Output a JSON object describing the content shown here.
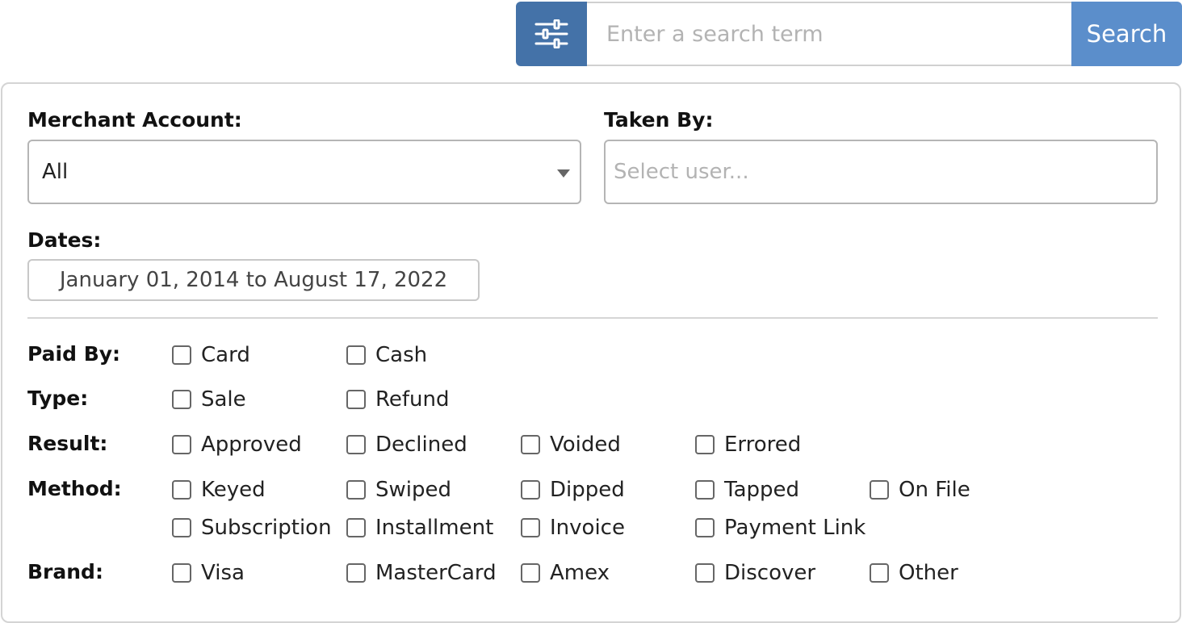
{
  "search": {
    "filter_icon": "sliders-icon",
    "placeholder": "Enter a search term",
    "value": "",
    "button_label": "Search"
  },
  "filters": {
    "merchant": {
      "label": "Merchant Account:",
      "selected": "All"
    },
    "taken_by": {
      "label": "Taken By:",
      "placeholder": "Select user..."
    },
    "dates": {
      "label": "Dates:",
      "range": "January 01, 2014 to August 17, 2022"
    },
    "paid_by": {
      "label": "Paid By:",
      "options": [
        "Card",
        "Cash"
      ]
    },
    "type": {
      "label": "Type:",
      "options": [
        "Sale",
        "Refund"
      ]
    },
    "result": {
      "label": "Result:",
      "options": [
        "Approved",
        "Declined",
        "Voided",
        "Errored"
      ]
    },
    "method": {
      "label": "Method:",
      "options": [
        "Keyed",
        "Swiped",
        "Dipped",
        "Tapped",
        "On File",
        "Subscription",
        "Installment",
        "Invoice",
        "Payment Link"
      ]
    },
    "brand": {
      "label": "Brand:",
      "options": [
        "Visa",
        "MasterCard",
        "Amex",
        "Discover",
        "Other"
      ]
    }
  },
  "colors": {
    "filter_button": "#4472a8",
    "search_button": "#5b8ecb"
  }
}
